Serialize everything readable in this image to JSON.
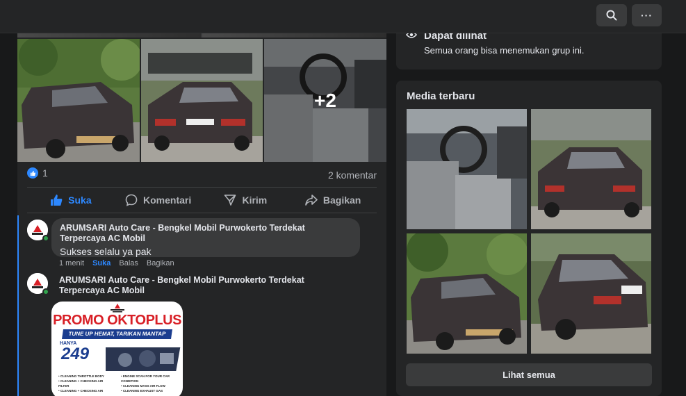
{
  "topbar": {
    "search_icon": "search-icon",
    "more_icon": "more-icon",
    "more_label": "···"
  },
  "post": {
    "more_photos_label": "+2",
    "reaction_count": "1",
    "comment_count_label": "2 komentar",
    "actions": {
      "like": "Suka",
      "comment": "Komentari",
      "send": "Kirim",
      "share": "Bagikan"
    },
    "accent_color": "#2d88ff"
  },
  "comments": [
    {
      "author": "ARUMSARI Auto Care - Bengkel Mobil Purwokerto Terdekat Terpercaya AC Mobil",
      "text": "Sukses selalu ya pak",
      "time": "1 menit",
      "like": "Suka",
      "reply": "Balas",
      "share": "Bagikan"
    },
    {
      "author": "ARUMSARI Auto Care - Bengkel Mobil Purwokerto Terdekat Terpercaya AC Mobil",
      "image": {
        "title": "PROMO OKTOPLUS",
        "subtitle": "TUNE UP HEMAT, TARIKAN MANTAP",
        "hanya": "HANYA",
        "price": "249",
        "list_left": [
          "• CLEANING THROTTLE BODY",
          "• CLEANING + CHECKING AIR FILTER",
          "• CLEANING + CHECKING AIR"
        ],
        "list_right": [
          "• ENGINE SCAN FOR YOUR CAR CONDITION",
          "• CLEANING MASS AIR FLOW",
          "• CLEANING EXHAUST GAS"
        ]
      }
    }
  ],
  "sidebar": {
    "visibility_title": "Dapat dilihat",
    "visibility_desc": "Semua orang bisa menemukan grup ini.",
    "media_title": "Media terbaru",
    "see_all": "Lihat semua"
  }
}
